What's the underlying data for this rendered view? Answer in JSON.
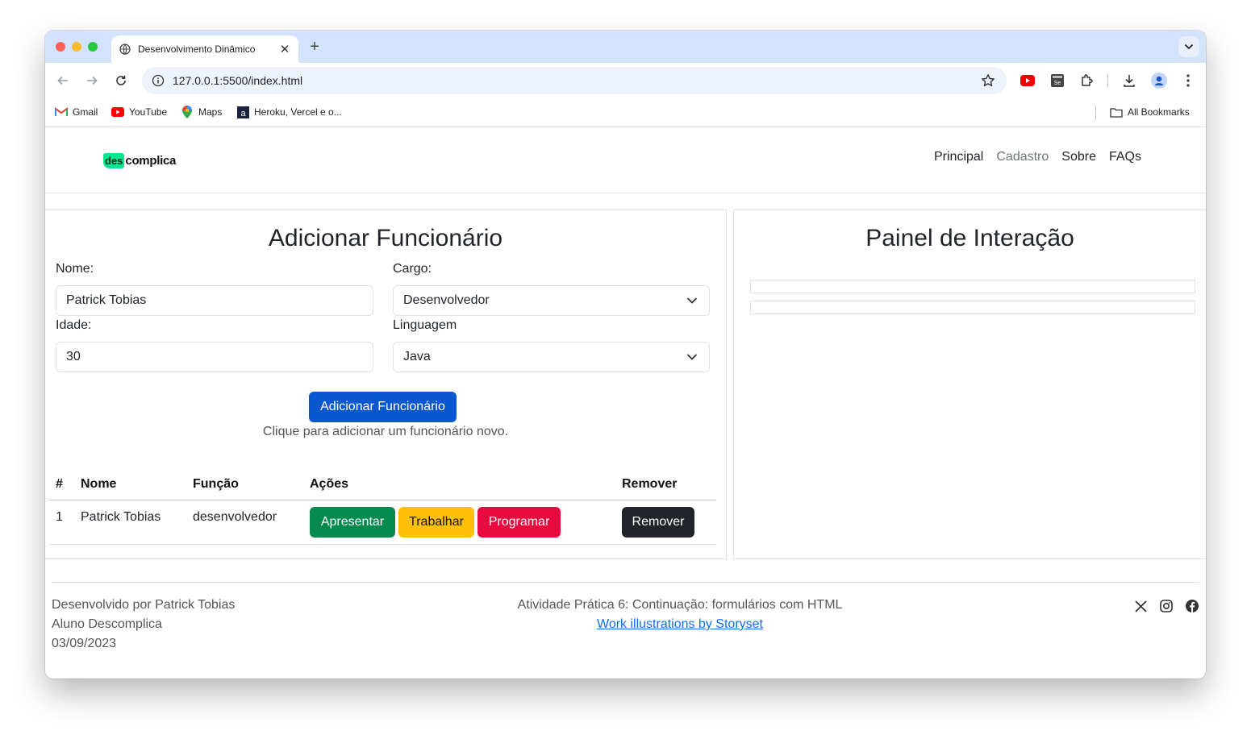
{
  "browser": {
    "tab_title": "Desenvolvimento Dinâmico",
    "url": "127.0.0.1:5500/index.html",
    "bookmarks": [
      {
        "label": "Gmail",
        "icon": "gmail-icon"
      },
      {
        "label": "YouTube",
        "icon": "youtube-icon"
      },
      {
        "label": "Maps",
        "icon": "maps-icon"
      },
      {
        "label": "Heroku, Vercel e o...",
        "icon": "bookmark-site-icon"
      }
    ],
    "all_bookmarks": "All Bookmarks"
  },
  "site": {
    "logo_mark": "des",
    "logo_text": "complica",
    "menu": [
      {
        "label": "Principal",
        "active": false
      },
      {
        "label": "Cadastro",
        "active": true
      },
      {
        "label": "Sobre",
        "active": false
      },
      {
        "label": "FAQs",
        "active": false
      }
    ]
  },
  "form": {
    "title": "Adicionar Funcionário",
    "name_label": "Nome:",
    "name_value": "Patrick Tobias",
    "role_label": "Cargo:",
    "role_value": "Desenvolvedor",
    "age_label": "Idade:",
    "age_value": "30",
    "language_label": "Linguagem",
    "language_value": "Java",
    "submit_label": "Adicionar Funcionário",
    "hint": "Clique para adicionar um funcionário novo."
  },
  "table": {
    "headers": {
      "num": "#",
      "name": "Nome",
      "role": "Função",
      "actions": "Ações",
      "remove": "Remover"
    },
    "rows": [
      {
        "num": "1",
        "name": "Patrick Tobias",
        "role": "desenvolvedor",
        "present": "Apresentar",
        "work": "Trabalhar",
        "program": "Programar",
        "remove": "Remover"
      }
    ]
  },
  "interaction": {
    "title": "Painel de Interação"
  },
  "footer": {
    "left": [
      "Desenvolvido por Patrick Tobias",
      "Aluno Descomplica",
      "03/09/2023"
    ],
    "center": "Atividade Prática 6: Continuação: formulários com HTML",
    "link": "Work illustrations by Storyset",
    "social": [
      "x-icon",
      "instagram-icon",
      "facebook-icon"
    ]
  },
  "colors": {
    "primary": "#0b57d0",
    "success": "#078a4e",
    "warning": "#ffc107",
    "danger": "#e8093e",
    "dark": "#212529",
    "logo": "#00e88f"
  }
}
